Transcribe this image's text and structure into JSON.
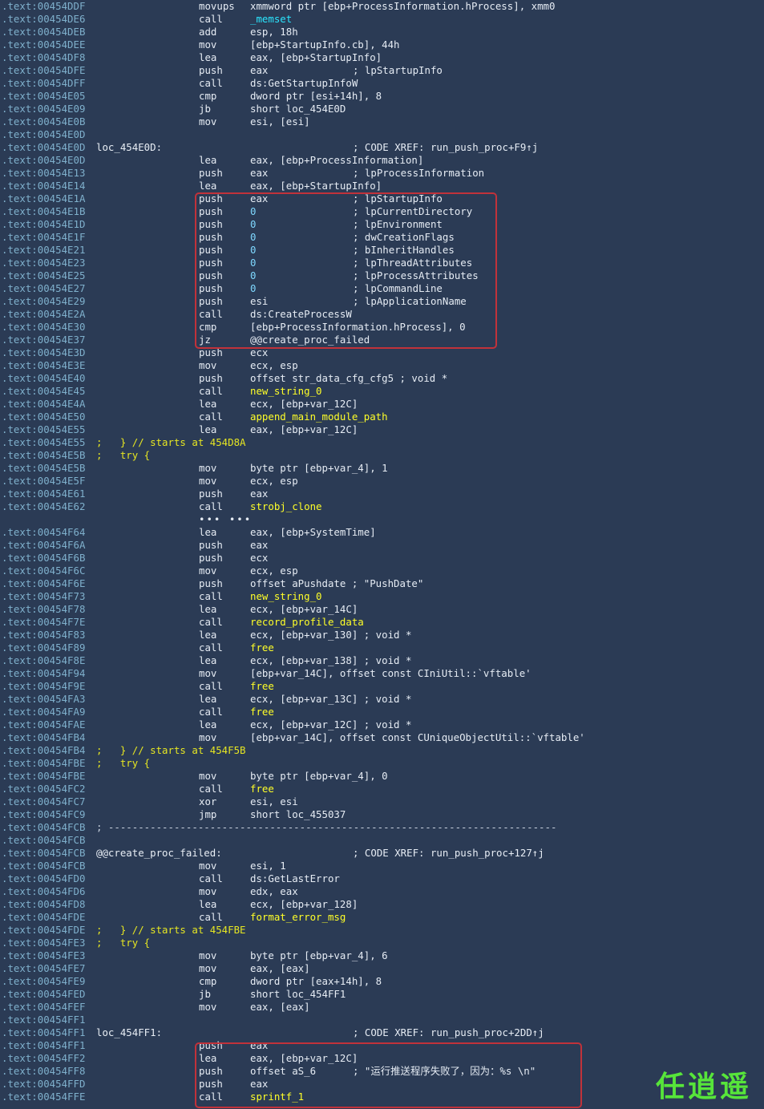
{
  "colors": {
    "background": "#2b3b55",
    "address": "#7fb0cc",
    "text": "#e6ecf4",
    "function": "#ffff28",
    "import": "#2ae6ff",
    "variable": "#66e8a6",
    "highlight_box": "#c1323a",
    "watermark": "#57e53a"
  },
  "watermark": "任逍遥",
  "lines": [
    {
      "addr": ".text:00454DDF",
      "mn": "movups",
      "op": "xmmword ptr [ebp+ProcessInformation.hProcess], xmm0"
    },
    {
      "addr": ".text:00454DE6",
      "mn": "call",
      "op": "_memset",
      "opcls": "sym-cyan"
    },
    {
      "addr": ".text:00454DEB",
      "mn": "add",
      "op": "esp, 18h"
    },
    {
      "addr": ".text:00454DEE",
      "mn": "mov",
      "op": "[ebp+StartupInfo.cb], 44h"
    },
    {
      "addr": ".text:00454DF8",
      "mn": "lea",
      "op": "eax, [ebp+StartupInfo]"
    },
    {
      "addr": ".text:00454DFE",
      "mn": "push",
      "op": "eax",
      "cm": "; lpStartupInfo"
    },
    {
      "addr": ".text:00454DFF",
      "mn": "call",
      "op": "ds:GetStartupInfoW"
    },
    {
      "addr": ".text:00454E05",
      "mn": "cmp",
      "op": "dword ptr [esi+14h], 8"
    },
    {
      "addr": ".text:00454E09",
      "mn": "jb",
      "op": "short loc_454E0D"
    },
    {
      "addr": ".text:00454E0B",
      "mn": "mov",
      "op": "esi, [esi]"
    },
    {
      "addr": ".text:00454E0D"
    },
    {
      "addr": ".text:00454E0D",
      "label": "loc_454E0D:",
      "cm": "; CODE XREF: run_push_proc+F9↑j"
    },
    {
      "addr": ".text:00454E0D",
      "mn": "lea",
      "op": "eax, [ebp+ProcessInformation]"
    },
    {
      "addr": ".text:00454E13",
      "mn": "push",
      "op": "eax",
      "cm": "; lpProcessInformation"
    },
    {
      "addr": ".text:00454E14",
      "mn": "lea",
      "op": "eax, [ebp+StartupInfo]"
    },
    {
      "addr": ".text:00454E1A",
      "mn": "push",
      "op": "eax",
      "cm": "; lpStartupInfo"
    },
    {
      "addr": ".text:00454E1B",
      "mn": "push",
      "op": "0",
      "cm": "; lpCurrentDirectory",
      "opcls": "sym-num"
    },
    {
      "addr": ".text:00454E1D",
      "mn": "push",
      "op": "0",
      "cm": "; lpEnvironment",
      "opcls": "sym-num"
    },
    {
      "addr": ".text:00454E1F",
      "mn": "push",
      "op": "0",
      "cm": "; dwCreationFlags",
      "opcls": "sym-num"
    },
    {
      "addr": ".text:00454E21",
      "mn": "push",
      "op": "0",
      "cm": "; bInheritHandles",
      "opcls": "sym-num"
    },
    {
      "addr": ".text:00454E23",
      "mn": "push",
      "op": "0",
      "cm": "; lpThreadAttributes",
      "opcls": "sym-num"
    },
    {
      "addr": ".text:00454E25",
      "mn": "push",
      "op": "0",
      "cm": "; lpProcessAttributes",
      "opcls": "sym-num"
    },
    {
      "addr": ".text:00454E27",
      "mn": "push",
      "op": "0",
      "cm": "; lpCommandLine",
      "opcls": "sym-num"
    },
    {
      "addr": ".text:00454E29",
      "mn": "push",
      "op": "esi",
      "cm": "; lpApplicationName"
    },
    {
      "addr": ".text:00454E2A",
      "mn": "call",
      "op": "ds:CreateProcessW"
    },
    {
      "addr": ".text:00454E30",
      "mn": "cmp",
      "op": "[ebp+ProcessInformation.hProcess], 0"
    },
    {
      "addr": ".text:00454E37",
      "mn": "jz",
      "op": "@@create_proc_failed"
    },
    {
      "addr": ".text:00454E3D",
      "mn": "push",
      "op": "ecx"
    },
    {
      "addr": ".text:00454E3E",
      "mn": "mov",
      "op": "ecx, esp"
    },
    {
      "addr": ".text:00454E40",
      "mn": "push",
      "op": "offset str_data_cfg_cfg5 ; void *"
    },
    {
      "addr": ".text:00454E45",
      "mn": "call",
      "op": "new_string_0",
      "opcls": "sym-yellow"
    },
    {
      "addr": ".text:00454E4A",
      "mn": "lea",
      "op": "ecx, [ebp+var_12C]"
    },
    {
      "addr": ".text:00454E50",
      "mn": "call",
      "op": "append_main_module_path",
      "opcls": "sym-yellow"
    },
    {
      "addr": ".text:00454E55",
      "mn": "lea",
      "op": "eax, [ebp+var_12C]"
    },
    {
      "addr": ".text:00454E55",
      "inline": ";   } // starts at 454D8A"
    },
    {
      "addr": ".text:00454E5B",
      "inline": ";   try {"
    },
    {
      "addr": ".text:00454E5B",
      "mn": "mov",
      "op": "byte ptr [ebp+var_4], 1"
    },
    {
      "addr": ".text:00454E5F",
      "mn": "mov",
      "op": "ecx, esp"
    },
    {
      "addr": ".text:00454E61",
      "mn": "push",
      "op": "eax"
    },
    {
      "addr": ".text:00454E62",
      "mn": "call",
      "op": "strobj_clone",
      "opcls": "sym-yellow"
    },
    {
      "dots": "••• •••"
    },
    {
      "addr": ".text:00454F64",
      "mn": "lea",
      "op": "eax, [ebp+SystemTime]"
    },
    {
      "addr": ".text:00454F6A",
      "mn": "push",
      "op": "eax"
    },
    {
      "addr": ".text:00454F6B",
      "mn": "push",
      "op": "ecx"
    },
    {
      "addr": ".text:00454F6C",
      "mn": "mov",
      "op": "ecx, esp"
    },
    {
      "addr": ".text:00454F6E",
      "mn": "push",
      "op": "offset aPushdate ; \"PushDate\""
    },
    {
      "addr": ".text:00454F73",
      "mn": "call",
      "op": "new_string_0",
      "opcls": "sym-yellow"
    },
    {
      "addr": ".text:00454F78",
      "mn": "lea",
      "op": "ecx, [ebp+var_14C]"
    },
    {
      "addr": ".text:00454F7E",
      "mn": "call",
      "op": "record_profile_data",
      "opcls": "sym-yellow"
    },
    {
      "addr": ".text:00454F83",
      "mn": "lea",
      "op": "ecx, [ebp+var_130] ; void *"
    },
    {
      "addr": ".text:00454F89",
      "mn": "call",
      "op": "free",
      "opcls": "sym-yellow"
    },
    {
      "addr": ".text:00454F8E",
      "mn": "lea",
      "op": "ecx, [ebp+var_138] ; void *"
    },
    {
      "addr": ".text:00454F94",
      "mn": "mov",
      "op": "[ebp+var_14C], offset const CIniUtil::`vftable'"
    },
    {
      "addr": ".text:00454F9E",
      "mn": "call",
      "op": "free",
      "opcls": "sym-yellow"
    },
    {
      "addr": ".text:00454FA3",
      "mn": "lea",
      "op": "ecx, [ebp+var_13C] ; void *"
    },
    {
      "addr": ".text:00454FA9",
      "mn": "call",
      "op": "free",
      "opcls": "sym-yellow"
    },
    {
      "addr": ".text:00454FAE",
      "mn": "lea",
      "op": "ecx, [ebp+var_12C] ; void *"
    },
    {
      "addr": ".text:00454FB4",
      "mn": "mov",
      "op": "[ebp+var_14C], offset const CUniqueObjectUtil::`vftable'"
    },
    {
      "addr": ".text:00454FB4",
      "inline": ";   } // starts at 454F5B"
    },
    {
      "addr": ".text:00454FBE",
      "inline": ";   try {"
    },
    {
      "addr": ".text:00454FBE",
      "mn": "mov",
      "op": "byte ptr [ebp+var_4], 0"
    },
    {
      "addr": ".text:00454FC2",
      "mn": "call",
      "op": "free",
      "opcls": "sym-yellow"
    },
    {
      "addr": ".text:00454FC7",
      "mn": "xor",
      "op": "esi, esi"
    },
    {
      "addr": ".text:00454FC9",
      "mn": "jmp",
      "op": "short loc_455037"
    },
    {
      "addr": ".text:00454FCB",
      "sep": "; ---------------------------------------------------------------------------"
    },
    {
      "addr": ".text:00454FCB"
    },
    {
      "addr": ".text:00454FCB",
      "label": "@@create_proc_failed:",
      "cm": "; CODE XREF: run_push_proc+127↑j"
    },
    {
      "addr": ".text:00454FCB",
      "mn": "mov",
      "op": "esi, 1"
    },
    {
      "addr": ".text:00454FD0",
      "mn": "call",
      "op": "ds:GetLastError"
    },
    {
      "addr": ".text:00454FD6",
      "mn": "mov",
      "op": "edx, eax"
    },
    {
      "addr": ".text:00454FD8",
      "mn": "lea",
      "op": "ecx, [ebp+var_128]"
    },
    {
      "addr": ".text:00454FDE",
      "mn": "call",
      "op": "format_error_msg",
      "opcls": "sym-yellow"
    },
    {
      "addr": ".text:00454FDE",
      "inline": ";   } // starts at 454FBE"
    },
    {
      "addr": ".text:00454FE3",
      "inline": ";   try {"
    },
    {
      "addr": ".text:00454FE3",
      "mn": "mov",
      "op": "byte ptr [ebp+var_4], 6"
    },
    {
      "addr": ".text:00454FE7",
      "mn": "mov",
      "op": "eax, [eax]"
    },
    {
      "addr": ".text:00454FE9",
      "mn": "cmp",
      "op": "dword ptr [eax+14h], 8"
    },
    {
      "addr": ".text:00454FED",
      "mn": "jb",
      "op": "short loc_454FF1"
    },
    {
      "addr": ".text:00454FEF",
      "mn": "mov",
      "op": "eax, [eax]"
    },
    {
      "addr": ".text:00454FF1"
    },
    {
      "addr": ".text:00454FF1",
      "label": "loc_454FF1:",
      "cm": "; CODE XREF: run_push_proc+2DD↑j"
    },
    {
      "addr": ".text:00454FF1",
      "mn": "push",
      "op": "eax"
    },
    {
      "addr": ".text:00454FF2",
      "mn": "lea",
      "op": "eax, [ebp+var_12C]"
    },
    {
      "addr": ".text:00454FF8",
      "mn": "push",
      "op": "offset aS_6",
      "cm": "; \"运行推送程序失败了，因为：%s \\n\""
    },
    {
      "addr": ".text:00454FFD",
      "mn": "push",
      "op": "eax"
    },
    {
      "addr": ".text:00454FFE",
      "mn": "call",
      "op": "sprintf_1",
      "opcls": "sym-yellow"
    }
  ]
}
